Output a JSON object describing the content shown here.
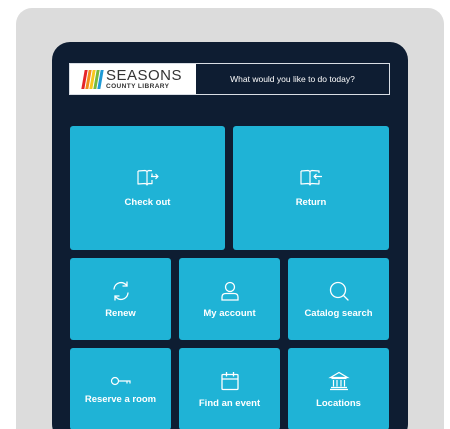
{
  "header": {
    "logo_main": "SEASONS",
    "logo_sub": "COUNTY LIBRARY",
    "prompt": "What would you like to do today?"
  },
  "colors": {
    "background": "#dcdcdc",
    "device": "#0e1d32",
    "tile": "#1fb3d6",
    "logo_stripes": [
      "#e5252a",
      "#f28c1b",
      "#f7c81d",
      "#79b93b",
      "#1f9ad6"
    ]
  },
  "tiles": [
    {
      "label": "Check out",
      "icon": "book-arrow-out-icon"
    },
    {
      "label": "Return",
      "icon": "book-arrow-in-icon"
    },
    {
      "label": "Renew",
      "icon": "refresh-icon"
    },
    {
      "label": "My account",
      "icon": "user-icon"
    },
    {
      "label": "Catalog search",
      "icon": "search-icon"
    },
    {
      "label": "Reserve a room",
      "icon": "key-icon"
    },
    {
      "label": "Find an event",
      "icon": "calendar-icon"
    },
    {
      "label": "Locations",
      "icon": "building-icon"
    }
  ]
}
